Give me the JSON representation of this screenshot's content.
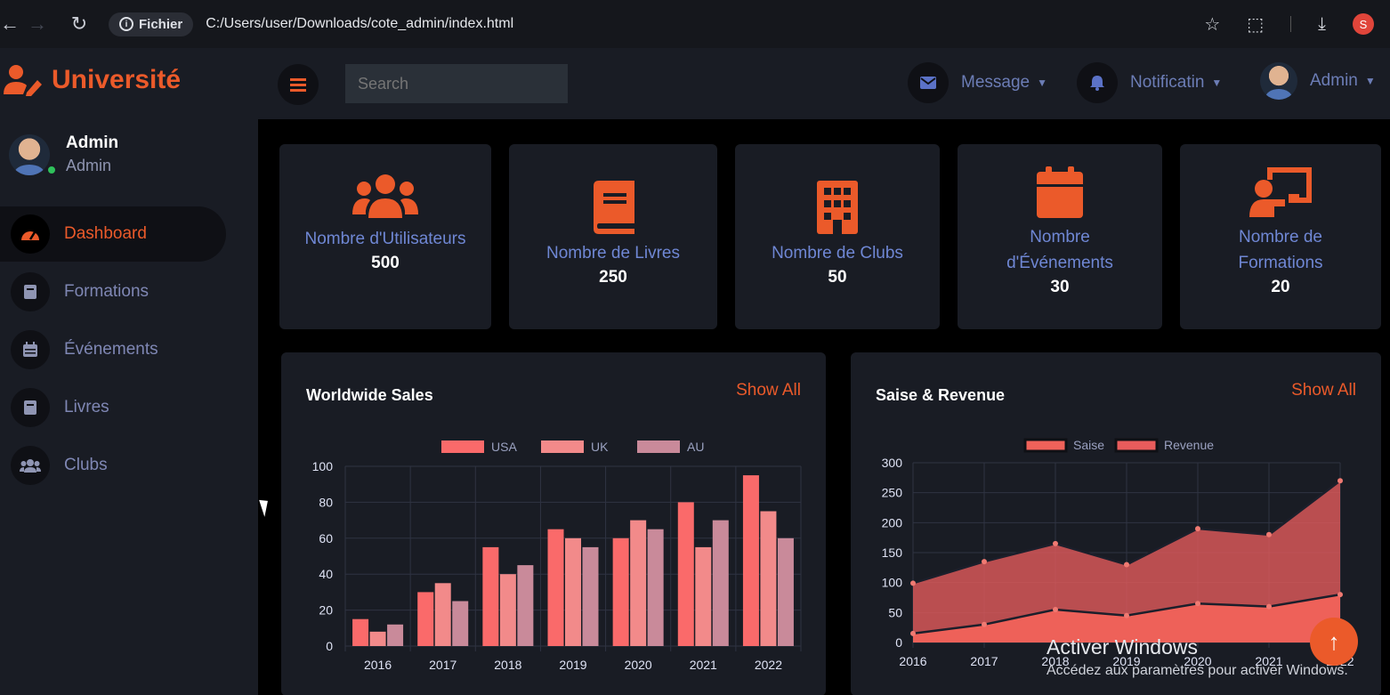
{
  "browser": {
    "site_info": "Fichier",
    "url": "C:/Users/user/Downloads/cote_admin/index.html",
    "profile_initial": "S"
  },
  "brand": {
    "name": "Université",
    "color": "#eb5a2a",
    "icon": "user-edit-icon"
  },
  "sidebar": {
    "user": {
      "name": "Admin",
      "role": "Admin"
    },
    "items": [
      {
        "label": "Dashboard",
        "icon": "tachometer-icon",
        "active": true
      },
      {
        "label": "Formations",
        "icon": "book-icon",
        "active": false
      },
      {
        "label": "Événements",
        "icon": "calendar-icon",
        "active": false
      },
      {
        "label": "Livres",
        "icon": "book-icon",
        "active": false
      },
      {
        "label": "Clubs",
        "icon": "users-icon",
        "active": false
      }
    ]
  },
  "navbar": {
    "search_placeholder": "Search",
    "message_label": "Message",
    "notification_label": "Notificatin",
    "admin_label": "Admin"
  },
  "stats": [
    {
      "label": "Nombre d'Utilisateurs",
      "value": "500",
      "icon": "users-icon"
    },
    {
      "label": "Nombre de Livres",
      "value": "250",
      "icon": "book-icon"
    },
    {
      "label": "Nombre de Clubs",
      "value": "50",
      "icon": "building-icon"
    },
    {
      "label": "Nombre d'Événements",
      "value": "30",
      "icon": "calendar-icon"
    },
    {
      "label": "Nombre de Formations",
      "value": "20",
      "icon": "chalkboard-teacher-icon"
    }
  ],
  "panels": {
    "sales_title": "Worldwide Sales",
    "revenue_title": "Saise & Revenue",
    "show_all": "Show All"
  },
  "watermark": {
    "line1": "Activer Windows",
    "line2": "Accédez aux paramètres pour activer Windows."
  },
  "chart_data": [
    {
      "type": "bar",
      "title": "Worldwide Sales",
      "categories": [
        "2016",
        "2017",
        "2018",
        "2019",
        "2020",
        "2021",
        "2022"
      ],
      "series": [
        {
          "name": "USA",
          "values": [
            15,
            30,
            55,
            65,
            60,
            80,
            95
          ],
          "color": "#fa6a6a"
        },
        {
          "name": "UK",
          "values": [
            8,
            35,
            40,
            60,
            70,
            55,
            75
          ],
          "color": "#f28a8a"
        },
        {
          "name": "AU",
          "values": [
            12,
            25,
            45,
            55,
            65,
            70,
            60
          ],
          "color": "#c98a9a"
        }
      ],
      "ylim": [
        0,
        100
      ],
      "yticks": [
        0,
        20,
        40,
        60,
        80,
        100
      ],
      "legend": "top",
      "grid": true
    },
    {
      "type": "area",
      "title": "Saise & Revenue",
      "x": [
        "2016",
        "2017",
        "2018",
        "2019",
        "2020",
        "2021",
        "2022"
      ],
      "series": [
        {
          "name": "Saise",
          "values": [
            15,
            30,
            55,
            45,
            65,
            60,
            80
          ],
          "color": "#f0625a"
        },
        {
          "name": "Revenue",
          "values": [
            99,
            135,
            165,
            130,
            190,
            180,
            270
          ],
          "color": "#e85c5c"
        }
      ],
      "ylim": [
        0,
        300
      ],
      "yticks": [
        0,
        50,
        100,
        150,
        200,
        250,
        300
      ],
      "legend": "top",
      "grid": true
    }
  ]
}
